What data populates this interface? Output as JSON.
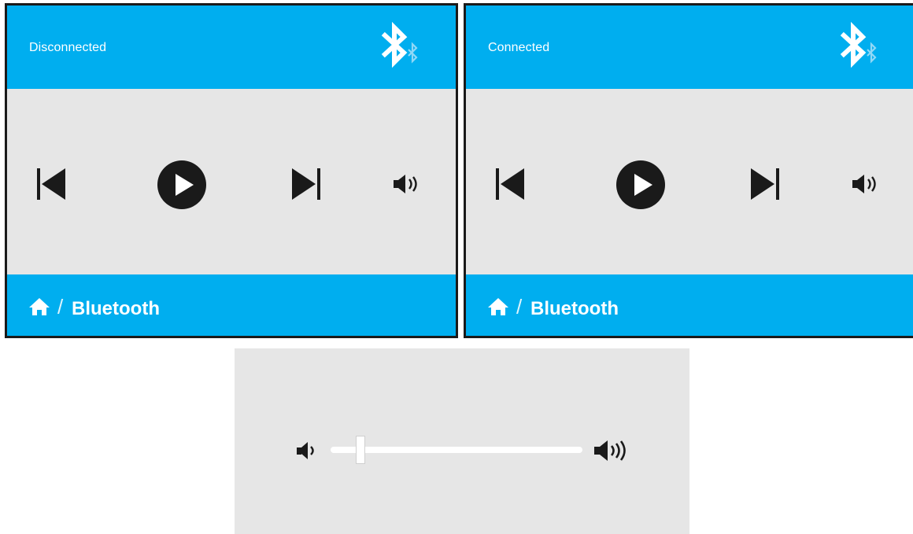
{
  "screens": [
    {
      "status": "Disconnected",
      "breadcrumb_label": "Bluetooth"
    },
    {
      "status": "Connected",
      "breadcrumb_label": "Bluetooth"
    }
  ],
  "breadcrumb_separator": "/",
  "volume": {
    "level": 0.12
  },
  "colors": {
    "accent": "#00aeef",
    "panel_background": "#e6e6e6",
    "icon": "#1a1a1a",
    "text_on_accent": "#ffffff"
  },
  "icons": {
    "bluetooth": "bluetooth-icon",
    "previous": "skip-previous-icon",
    "play": "play-icon",
    "next": "skip-next-icon",
    "volume": "volume-icon",
    "home": "home-icon",
    "volume_low": "volume-low-icon",
    "volume_high": "volume-high-icon"
  }
}
